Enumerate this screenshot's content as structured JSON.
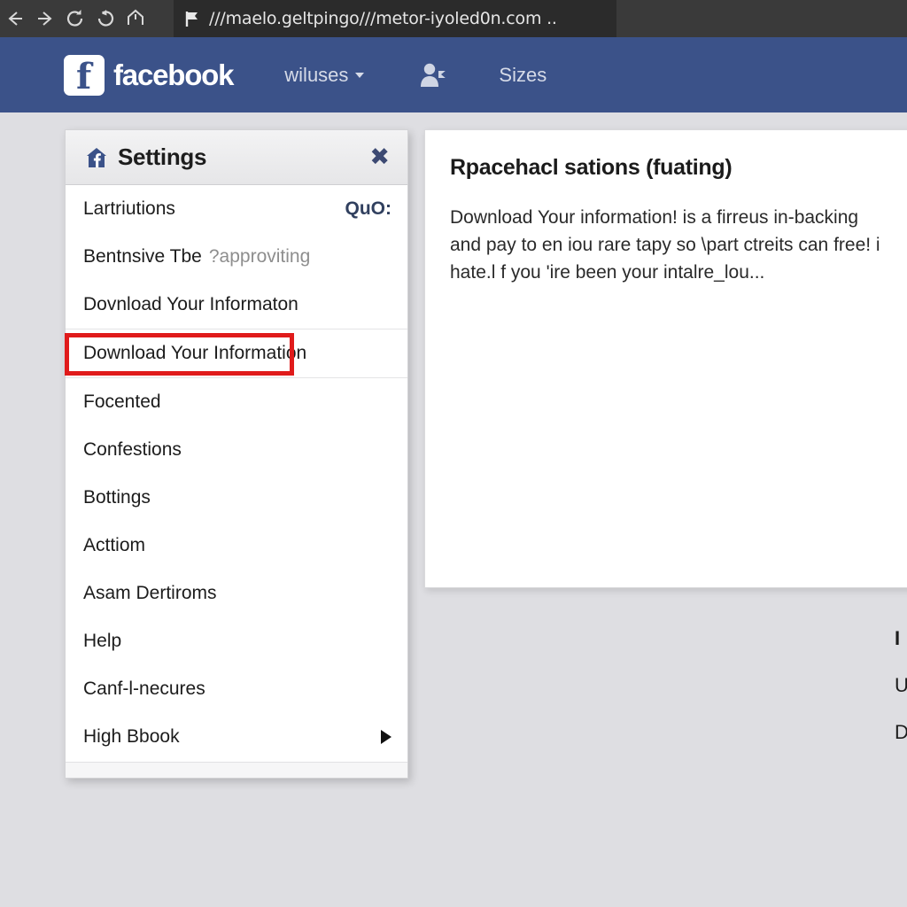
{
  "browser": {
    "icons": [
      "back-arrow-icon",
      "forward-arrow-icon",
      "reload-icon",
      "reload-alt-icon",
      "home-icon"
    ],
    "url": "///maelo.geltpingo///metor-iyoled0n.com ..",
    "site_icon": "flag-icon"
  },
  "fb_header": {
    "logo_letter": "f",
    "wordmark": "facebook",
    "nav": [
      {
        "label": "wiluses",
        "has_caret": true
      },
      {
        "label": "Sizes",
        "has_caret": false
      }
    ],
    "friends_icon": "friend-request-icon",
    "bar_color": "#3b5289"
  },
  "settings_panel": {
    "title": "Settings",
    "header_icon": "facebook-home-icon",
    "close_icon": "close-x-icon",
    "items": [
      {
        "label": "Lartriutions",
        "badge": "QuO:",
        "sub": "",
        "arrow": false
      },
      {
        "label": "Bentnsive Tbe",
        "badge": "",
        "sub": "?approviting",
        "arrow": false
      },
      {
        "label": "Dovnload Your Informaton",
        "badge": "",
        "sub": "",
        "arrow": false
      },
      {
        "label": "Download Your Informa",
        "badge": "",
        "sub": "",
        "arrow": false,
        "suffix": "tion",
        "highlighted": true
      },
      {
        "label": "Focented",
        "badge": "",
        "sub": "",
        "arrow": false
      },
      {
        "label": "Confestions",
        "badge": "",
        "sub": "",
        "arrow": false
      },
      {
        "label": "Bottings",
        "badge": "",
        "sub": "",
        "arrow": false
      },
      {
        "label": "Acttiom",
        "badge": "",
        "sub": "",
        "arrow": false
      },
      {
        "label": "Asam Dertiroms",
        "badge": "",
        "sub": "",
        "arrow": false
      },
      {
        "label": "Help",
        "badge": "",
        "sub": "",
        "arrow": false
      },
      {
        "label": "Canf-l-necures",
        "badge": "",
        "sub": "",
        "arrow": false
      },
      {
        "label": "High Bbook",
        "badge": "",
        "sub": "",
        "arrow": true
      }
    ],
    "highlight_color": "#e01b1b"
  },
  "content_panel": {
    "title": "Rpacehacl sations (fuating)",
    "body": "Download Your information! is a firreus in-backing\nand pay to en iou rare tapy so \\part ctreits can free! i\nhate.l f you 'ire been your intalre_lou..."
  },
  "edge_fragments": {
    "frag1": "I",
    "frag2": "U",
    "frag3": "D"
  }
}
